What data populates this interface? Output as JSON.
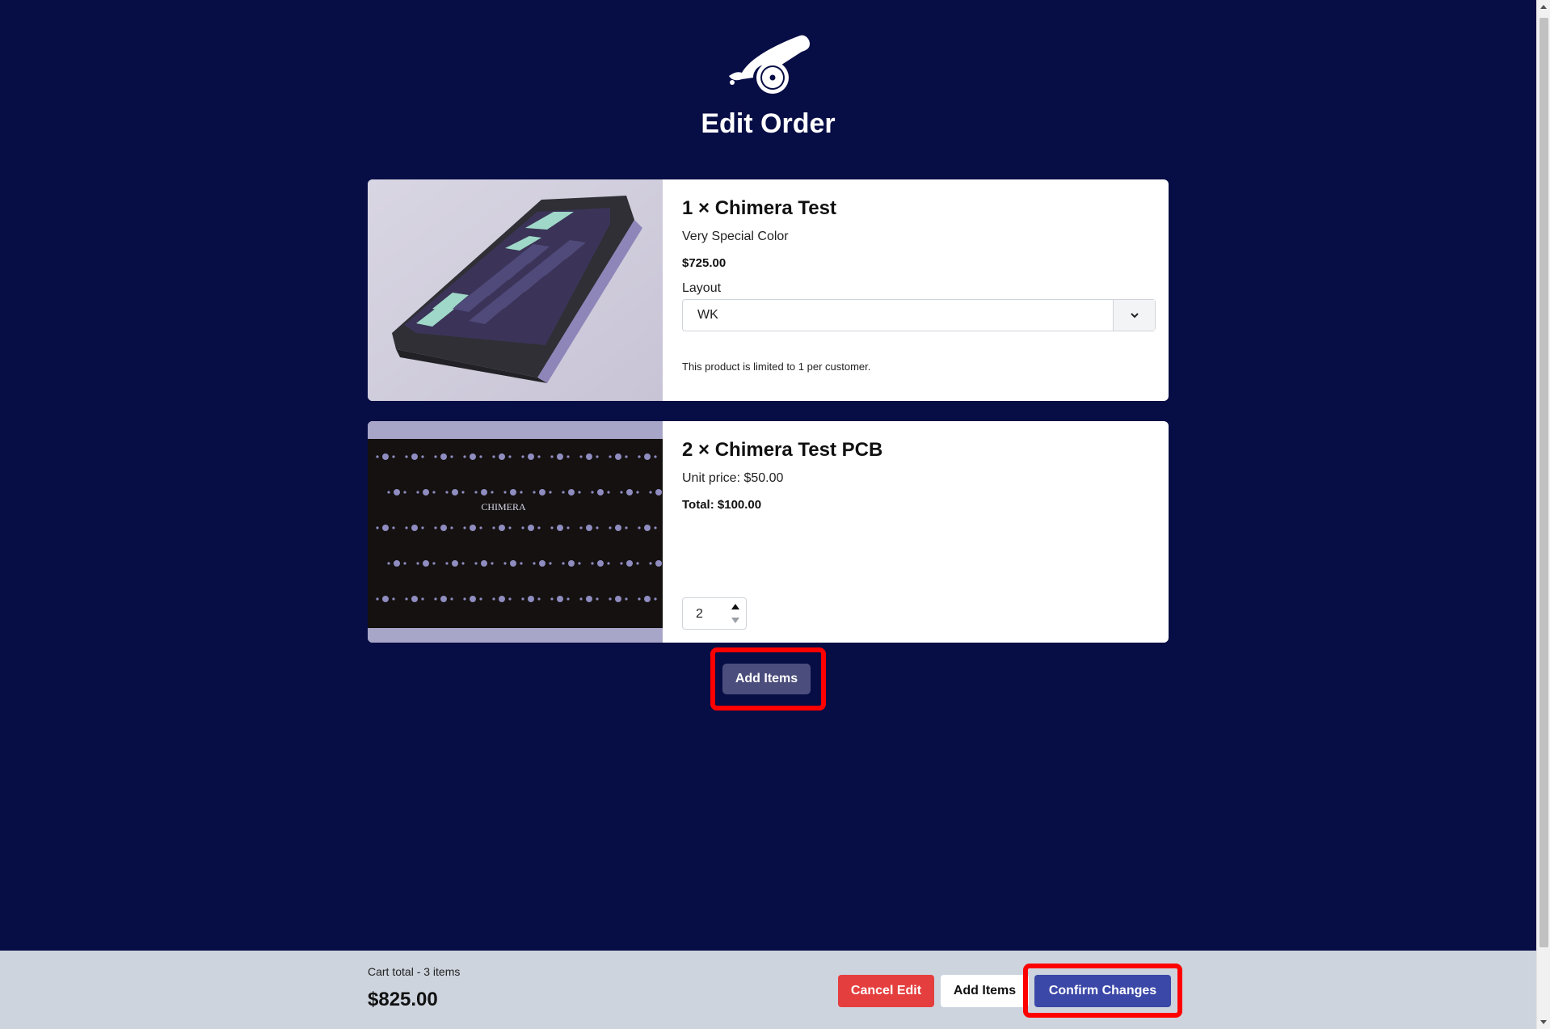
{
  "page": {
    "title": "Edit Order",
    "logo_icon": "cannon-icon"
  },
  "items": [
    {
      "title": "1 × Chimera Test",
      "variant": "Very Special Color",
      "price": "$725.00",
      "layout_label": "Layout",
      "layout_value": "WK",
      "note": "This product is limited to 1 per customer.",
      "image_icon": "keyboard-photo"
    },
    {
      "title": "2 × Chimera Test PCB",
      "unit_price": "Unit price: $50.00",
      "total": "Total: $100.00",
      "quantity": "2",
      "image_icon": "pcb-photo",
      "pcb_brand": "CHIMERA"
    }
  ],
  "add_items_label": "Add Items",
  "footer": {
    "cart_summary": "Cart total - 3 items",
    "cart_total": "$825.00",
    "cancel_label": "Cancel Edit",
    "add_label": "Add Items",
    "confirm_label": "Confirm Changes"
  },
  "colors": {
    "background": "#070d45",
    "cancel": "#e53e3e",
    "confirm": "#3b48a8",
    "highlight": "#ff0000"
  }
}
